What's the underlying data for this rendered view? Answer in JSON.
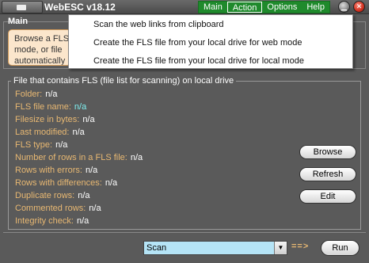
{
  "window": {
    "title": "WebESC v18.12"
  },
  "menu": {
    "items": [
      "Main",
      "Action",
      "Options",
      "Help"
    ]
  },
  "dropdown": {
    "items": [
      "Scan the web links from clipboard",
      "Create the FLS file from your local drive for web mode",
      "Create the FLS file from your local drive for local mode"
    ]
  },
  "main": {
    "tab_label": "Main",
    "info_lines": [
      "Browse a FLS",
      "mode, or file",
      "automatically"
    ]
  },
  "fls": {
    "legend": "File that contains FLS (file list for scanning) on local drive",
    "fields": [
      {
        "label": "Folder:",
        "value": "n/a"
      },
      {
        "label": "FLS file name:",
        "value": "n/a"
      },
      {
        "label": "Filesize in bytes:",
        "value": "n/a"
      },
      {
        "label": "Last modified:",
        "value": "n/a"
      },
      {
        "label": "FLS type:",
        "value": "n/a"
      },
      {
        "label": "Number of rows in a FLS file:",
        "value": "n/a"
      },
      {
        "label": "Rows with errors:",
        "value": "n/a"
      },
      {
        "label": "Rows with differences:",
        "value": "n/a"
      },
      {
        "label": "Duplicate rows:",
        "value": "n/a"
      },
      {
        "label": "Commented rows:",
        "value": "n/a"
      },
      {
        "label": "Integrity check:",
        "value": "n/a"
      }
    ],
    "buttons": {
      "browse": "Browse",
      "refresh": "Refresh",
      "edit": "Edit"
    }
  },
  "bottom": {
    "select_value": "Scan",
    "arrow_text": "==>",
    "run_label": "Run"
  },
  "colors": {
    "background": "#5a5a5a",
    "menubar": "#1f8a2c",
    "label": "#e8b872",
    "highlight_value": "#7ff0f0",
    "select_bg": "#b5e4f6",
    "info_box": "#fbe6cc"
  }
}
